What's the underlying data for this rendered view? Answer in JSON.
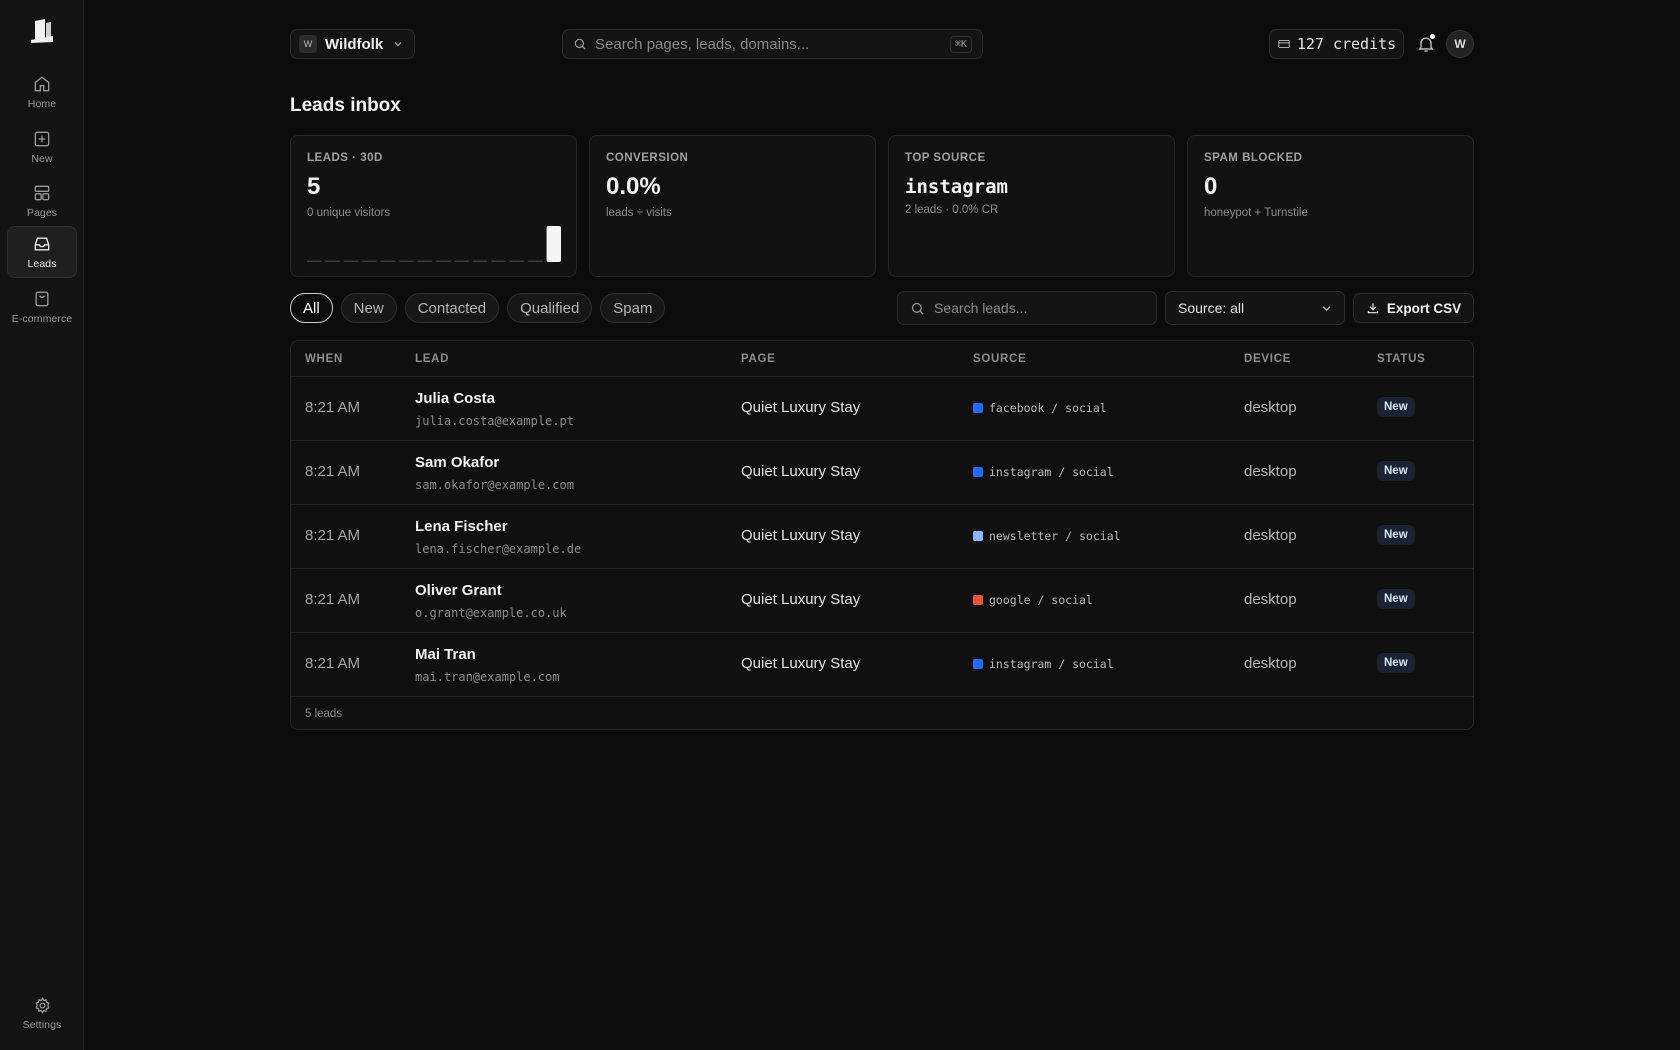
{
  "sidebar": {
    "items": [
      {
        "label": "Home",
        "icon": "home-icon"
      },
      {
        "label": "New",
        "icon": "plus-square-icon"
      },
      {
        "label": "Pages",
        "icon": "layout-icon"
      },
      {
        "label": "Leads",
        "icon": "inbox-icon",
        "active": true
      },
      {
        "label": "E-commerce",
        "icon": "shopping-bag-icon"
      }
    ],
    "settings_label": "Settings"
  },
  "header": {
    "workspace_initial": "W",
    "workspace_name": "Wildfolk",
    "search_placeholder": "Search pages, leads, domains...",
    "search_shortcut": "⌘K",
    "credits": "127 credits",
    "user_initial": "W"
  },
  "page": {
    "title": "Leads inbox"
  },
  "stats": {
    "leads": {
      "label": "LEADS · 30D",
      "value": "5",
      "sub": "0 unique visitors"
    },
    "conversion": {
      "label": "CONVERSION",
      "value": "0.0%",
      "sub": "leads ÷ visits"
    },
    "top_source": {
      "label": "TOP SOURCE",
      "value": "instagram",
      "sub": "2 leads · 0.0% CR"
    },
    "spam": {
      "label": "SPAM BLOCKED",
      "value": "0",
      "sub": "honeypot + Turnstile"
    }
  },
  "sparkline_values": [
    0,
    0,
    0,
    0,
    0,
    0,
    0,
    0,
    0,
    0,
    0,
    0,
    0,
    5
  ],
  "filters": {
    "tabs": [
      "All",
      "New",
      "Contacted",
      "Qualified",
      "Spam"
    ],
    "active": "All",
    "search_placeholder": "Search leads...",
    "source_select": "Source: all",
    "export_label": "Export CSV"
  },
  "table": {
    "headers": {
      "when": "WHEN",
      "lead": "LEAD",
      "page": "PAGE",
      "source": "SOURCE",
      "device": "DEVICE",
      "status": "STATUS"
    },
    "rows": [
      {
        "when": "8:21 AM",
        "name": "Julia Costa",
        "email": "julia.costa@example.pt",
        "page": "Quiet Luxury Stay",
        "source": "facebook / social",
        "source_color": "#1f6bff",
        "device": "desktop",
        "status": "New"
      },
      {
        "when": "8:21 AM",
        "name": "Sam Okafor",
        "email": "sam.okafor@example.com",
        "page": "Quiet Luxury Stay",
        "source": "instagram / social",
        "source_color": "#1f6bff",
        "device": "desktop",
        "status": "New"
      },
      {
        "when": "8:21 AM",
        "name": "Lena Fischer",
        "email": "lena.fischer@example.de",
        "page": "Quiet Luxury Stay",
        "source": "newsletter / social",
        "source_color": "#8fb4ff",
        "device": "desktop",
        "status": "New"
      },
      {
        "when": "8:21 AM",
        "name": "Oliver Grant",
        "email": "o.grant@example.co.uk",
        "page": "Quiet Luxury Stay",
        "source": "google / social",
        "source_color": "#e5533d",
        "device": "desktop",
        "status": "New"
      },
      {
        "when": "8:21 AM",
        "name": "Mai Tran",
        "email": "mai.tran@example.com",
        "page": "Quiet Luxury Stay",
        "source": "instagram / social",
        "source_color": "#1f6bff",
        "device": "desktop",
        "status": "New"
      }
    ],
    "footer": "5 leads"
  }
}
